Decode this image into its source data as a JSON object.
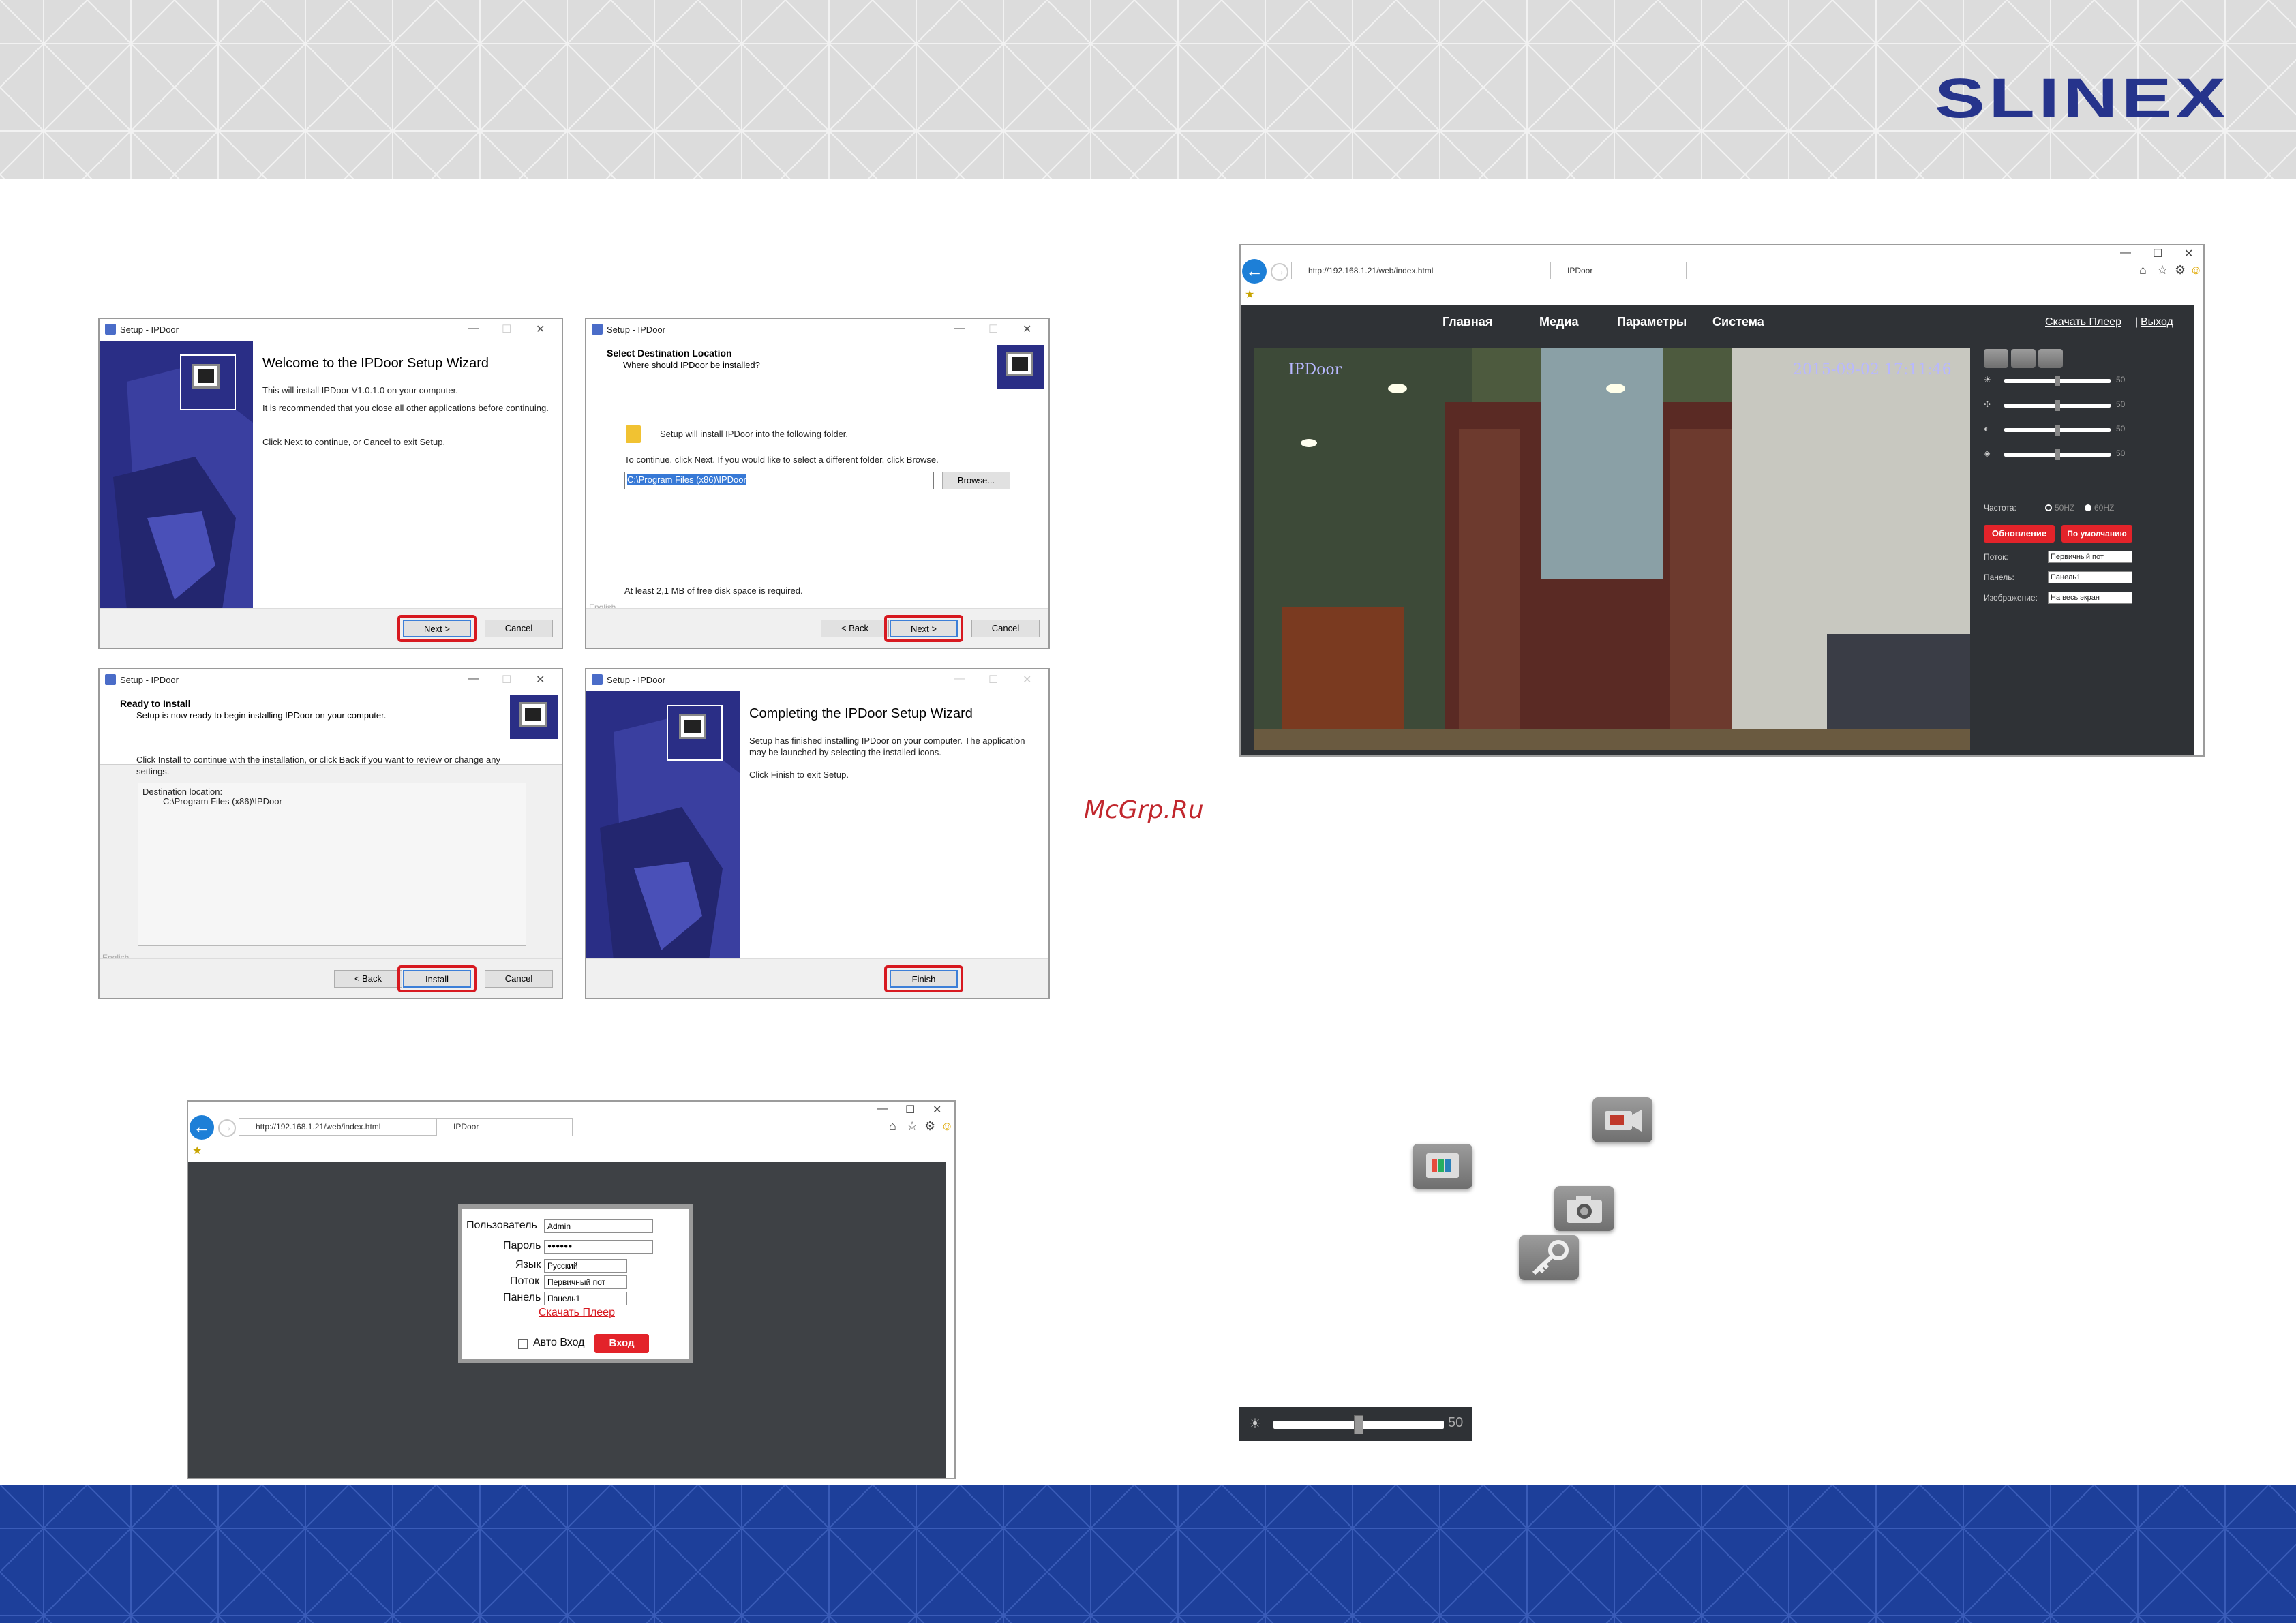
{
  "brand": {
    "logo": "SLINEX"
  },
  "watermark": "McGrp.Ru",
  "dialog_welcome": {
    "title": "Setup - IPDoor",
    "heading": "Welcome to the IPDoor Setup Wizard",
    "line1": "This will install IPDoor V1.0.1.0 on your computer.",
    "line2": "It is recommended that you close all other applications before continuing.",
    "line3": "Click Next to continue, or Cancel to exit Setup.",
    "next": "Next >",
    "cancel": "Cancel"
  },
  "dialog_destination": {
    "title": "Setup - IPDoor",
    "heading": "Select Destination Location",
    "subheading": "Where should IPDoor be installed?",
    "line1": "Setup will install IPDoor into the following folder.",
    "line2": "To continue, click Next. If you would like to select a different folder, click Browse.",
    "path": "C:\\Program Files (x86)\\IPDoor",
    "browse": "Browse...",
    "space": "At least 2,1 MB of free disk space is required.",
    "lang": "English",
    "back": "< Back",
    "next": "Next >",
    "cancel": "Cancel"
  },
  "dialog_ready": {
    "title": "Setup - IPDoor",
    "heading": "Ready to Install",
    "subheading": "Setup is now ready to begin installing IPDoor on your computer.",
    "line1": "Click Install to continue with the installation, or click Back if you want to review or change any settings.",
    "dest_label": "Destination location:",
    "dest_value": "C:\\Program Files (x86)\\IPDoor",
    "lang": "English",
    "back": "< Back",
    "install": "Install",
    "cancel": "Cancel"
  },
  "dialog_complete": {
    "title": "Setup - IPDoor",
    "heading": "Completing the IPDoor Setup Wizard",
    "line1": "Setup has finished installing IPDoor on your computer. The application may be launched by selecting the installed icons.",
    "line2": "Click Finish to exit Setup.",
    "finish": "Finish"
  },
  "login_browser": {
    "url": "http://192.168.1.21/web/index.html",
    "tab": "IPDoor",
    "user_label": "Пользователь",
    "user_value": "Admin",
    "pass_label": "Пароль",
    "pass_value": "●●●●●●",
    "lang_label": "Язык",
    "lang_value": "Русский",
    "stream_label": "Поток",
    "stream_value": "Первичный пот",
    "panel_label": "Панель",
    "panel_value": "Панель1",
    "download": "Скачать Плеер",
    "auto_login": "Авто Вход",
    "login_button": "Вход"
  },
  "camera_browser": {
    "url": "http://192.168.1.21/web/index.html",
    "tab": "IPDoor",
    "nav": [
      "Главная",
      "Медиа",
      "Параметры",
      "Система"
    ],
    "download": "Скачать Плеер",
    "logout": "Выход",
    "overlay_name": "IPDoor",
    "overlay_time": "2015-09-02  17:11:46",
    "sliders": [
      50,
      50,
      50,
      50
    ],
    "slider_labels": [
      "50",
      "50",
      "50",
      "50"
    ],
    "freq_label": "Частота:",
    "freq_60": "50HZ",
    "freq_other": "60HZ",
    "refresh_button": "Обновление",
    "default_button": "По умолчанию",
    "stream_label": "Поток:",
    "stream_value": "Первичный пот",
    "panel_label": "Панель:",
    "panel_value": "Панель1",
    "image_label": "Изображение:",
    "image_value": "На весь экран"
  },
  "brightness_bar": {
    "value_label": "50",
    "level": 0.5
  },
  "colors": {
    "brand": "#26348c",
    "accent_red": "#d71920",
    "footer": "#1d3f9a",
    "dark_ui": "#2f3236"
  }
}
